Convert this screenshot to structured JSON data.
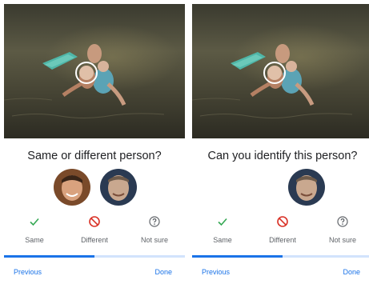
{
  "colors": {
    "accent": "#1a73e8",
    "progress_track": "#d2e3fc",
    "same": "#34a853",
    "different": "#d93025",
    "not_sure": "#5f6368"
  },
  "screens": [
    {
      "question": "Same or different person?",
      "options": [
        {
          "label": "Same",
          "icon": "check-icon"
        },
        {
          "label": "Different",
          "icon": "block-icon"
        },
        {
          "label": "Not sure",
          "icon": "help-circle-icon"
        }
      ],
      "progress": 0.5,
      "previous_label": "Previous",
      "done_label": "Done"
    },
    {
      "question": "Can you identify this person?",
      "options": [
        {
          "label": "Same",
          "icon": "check-icon"
        },
        {
          "label": "Different",
          "icon": "block-icon"
        },
        {
          "label": "Not sure",
          "icon": "help-circle-icon"
        }
      ],
      "progress": 0.5,
      "previous_label": "Previous",
      "done_label": "Done"
    }
  ]
}
